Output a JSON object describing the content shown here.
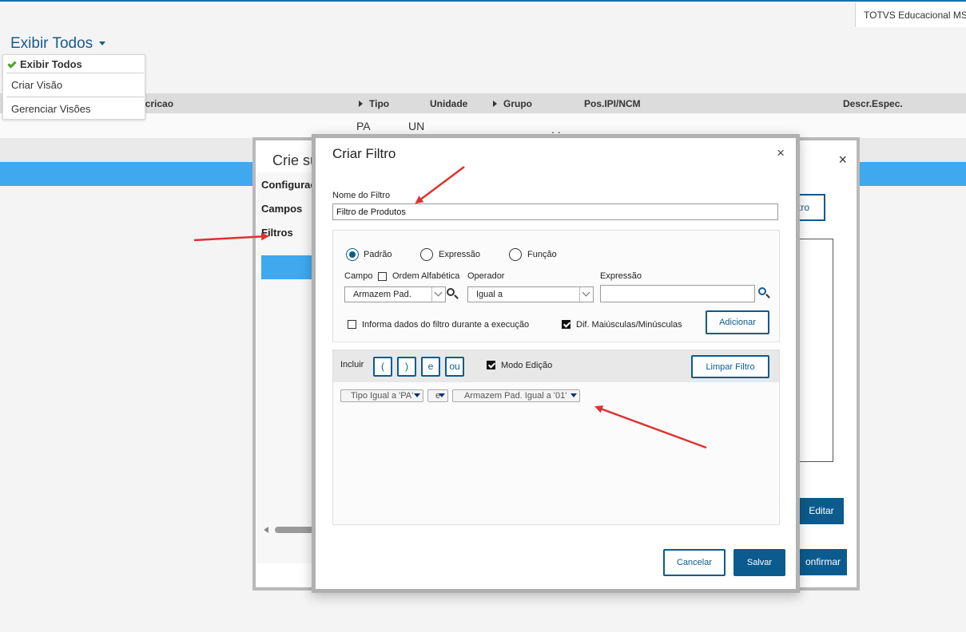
{
  "topbar": {
    "company": "TOTVS Educacional MSSQ"
  },
  "view": {
    "title": "Exibir Todos",
    "menu": [
      {
        "label": "Exibir Todos",
        "checked": true
      },
      {
        "label": "Criar Visão"
      },
      {
        "label": "Gerenciar Visões"
      }
    ]
  },
  "grid": {
    "headers": [
      "scricao",
      "Tipo",
      "Unidade",
      "Grupo",
      "Pos.IPI/NCM",
      "Descr.Espec."
    ],
    "row": {
      "tipo": "PA",
      "unidade": "UN",
      "ncm": ". ."
    }
  },
  "back_dialog": {
    "title": "Crie su",
    "close": "×",
    "sidebar": [
      "Configuraç",
      "Campos",
      "Filtros"
    ],
    "button_partial": "tro",
    "edit_label": "Editar",
    "confirm_label": "onfirmar"
  },
  "filter_dialog": {
    "title": "Criar Filtro",
    "close": "×",
    "name_label": "Nome do Filtro",
    "name_value": "Filtro de Produtos",
    "radios": [
      {
        "label": "Padrão",
        "selected": true
      },
      {
        "label": "Expressão",
        "selected": false
      },
      {
        "label": "Função",
        "selected": false
      }
    ],
    "campo_label": "Campo",
    "ordem_label": "Ordem Alfabética",
    "campo_value": "Armazem Pad.",
    "operador_label": "Operador",
    "operador_value": "Igual a",
    "expressao_label": "Expressão",
    "expressao_value": "",
    "informa_label": "Informa dados do filtro durante a execução",
    "dif_label": "Dif. Maiúsculas/Minúsculas",
    "adicionar_label": "Adicionar",
    "incluir_label": "Incluir",
    "tokens": [
      "(",
      ")",
      "e",
      "ou"
    ],
    "modo_label": "Modo Edição",
    "limpar_label": "Limpar Filtro",
    "chips": [
      "Tipo Igual a 'PA'",
      "e",
      "Armazem Pad. Igual a '01'"
    ],
    "cancel_label": "Cancelar",
    "save_label": "Salvar"
  },
  "colors": {
    "accent": "#0b5b8e",
    "band": "#3fa8ef",
    "arrow": "#e03030",
    "check": "#4aa329"
  }
}
